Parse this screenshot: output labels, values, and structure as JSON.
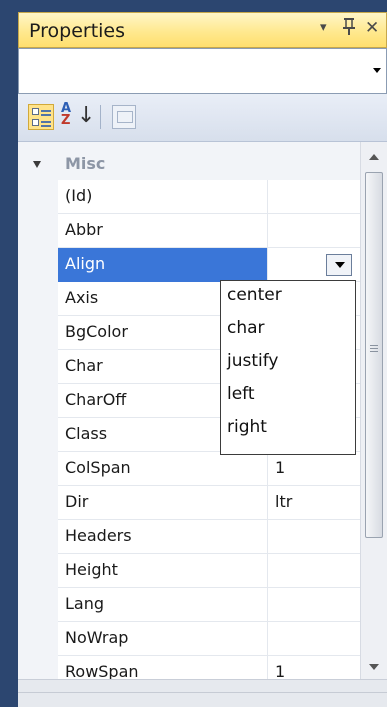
{
  "window": {
    "title": "Properties",
    "menu_icon": "▾",
    "pin_icon": "q",
    "close_icon": "✕"
  },
  "object_selector": {
    "value": ""
  },
  "toolbar": {
    "alpha_sort_a": "A",
    "alpha_sort_z": "Z"
  },
  "grid": {
    "category": "Misc",
    "rows": [
      {
        "name": "(Id)",
        "value": ""
      },
      {
        "name": "Abbr",
        "value": ""
      },
      {
        "name": "Align",
        "value": ""
      },
      {
        "name": "Axis",
        "value": ""
      },
      {
        "name": "BgColor",
        "value": ""
      },
      {
        "name": "Char",
        "value": ""
      },
      {
        "name": "CharOff",
        "value": ""
      },
      {
        "name": "Class",
        "value": ""
      },
      {
        "name": "ColSpan",
        "value": "1"
      },
      {
        "name": "Dir",
        "value": "ltr"
      },
      {
        "name": "Headers",
        "value": ""
      },
      {
        "name": "Height",
        "value": ""
      },
      {
        "name": "Lang",
        "value": ""
      },
      {
        "name": "NoWrap",
        "value": ""
      },
      {
        "name": "RowSpan",
        "value": "1"
      }
    ],
    "selected_index": 2
  },
  "align_dropdown": {
    "options": [
      "center",
      "char",
      "justify",
      "left",
      "right"
    ]
  },
  "colors": {
    "title_bar": "#ffe98f",
    "selection": "#3a76d8",
    "window_frame": "#2c4670"
  }
}
